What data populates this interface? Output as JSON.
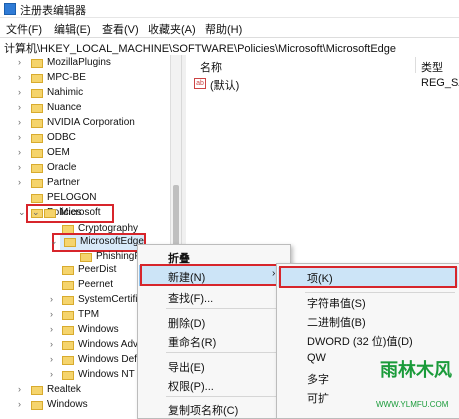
{
  "window": {
    "title": "注册表编辑器"
  },
  "menus": [
    "文件(F)",
    "编辑(E)",
    "查看(V)",
    "收藏夹(A)",
    "帮助(H)"
  ],
  "address": "计算机\\HKEY_LOCAL_MACHINE\\SOFTWARE\\Policies\\Microsoft\\MicrosoftEdge",
  "tree": {
    "items": [
      {
        "label": "MozillaPlugins",
        "arrow": "›"
      },
      {
        "label": "MPC-BE",
        "arrow": "›"
      },
      {
        "label": "Nahimic",
        "arrow": "›"
      },
      {
        "label": "Nuance",
        "arrow": "›"
      },
      {
        "label": "NVIDIA Corporation",
        "arrow": "›"
      },
      {
        "label": "ODBC",
        "arrow": "›"
      },
      {
        "label": "OEM",
        "arrow": "›"
      },
      {
        "label": "Oracle",
        "arrow": "›"
      },
      {
        "label": "Partner",
        "arrow": "›"
      },
      {
        "label": "PELOGON",
        "arrow": ""
      },
      {
        "label": "Policies",
        "arrow": "⌄"
      },
      {
        "label": "Microsoft",
        "arrow": "⌄"
      },
      {
        "label": "Cryptography",
        "arrow": ""
      },
      {
        "label": "MicrosoftEdge",
        "arrow": "⌄"
      },
      {
        "label": "PhishingFi",
        "arrow": ""
      },
      {
        "label": "PeerDist",
        "arrow": ""
      },
      {
        "label": "Peernet",
        "arrow": ""
      },
      {
        "label": "SystemCertific",
        "arrow": "›"
      },
      {
        "label": "TPM",
        "arrow": "›"
      },
      {
        "label": "Windows",
        "arrow": "›"
      },
      {
        "label": "Windows Adv",
        "arrow": "›"
      },
      {
        "label": "Windows Defe",
        "arrow": "›"
      },
      {
        "label": "Windows NT",
        "arrow": "›"
      },
      {
        "label": "Realtek",
        "arrow": "›"
      },
      {
        "label": "Windows",
        "arrow": "›"
      },
      {
        "label": "Windo",
        "arrow": "›"
      }
    ]
  },
  "list": {
    "columns": {
      "name": "名称",
      "type": "类型"
    },
    "rows": [
      {
        "icon": "ab",
        "name": "(默认)",
        "type": "REG_SZ"
      }
    ]
  },
  "context_menu": {
    "items": [
      "折叠",
      "新建(N)",
      "查找(F)...",
      "删除(D)",
      "重命名(R)",
      "导出(E)",
      "权限(P)...",
      "复制项名称(C)"
    ],
    "submenu_arrow": "›"
  },
  "submenu": {
    "items": [
      "项(K)",
      "字符串值(S)",
      "二进制值(B)",
      "DWORD (32 位)值(D)",
      "QW",
      "多字",
      "可扩"
    ]
  },
  "watermark": {
    "text": "雨林木风",
    "url": "WWW.YLMFU.COM"
  },
  "colors": {
    "highlight": "#d7252b",
    "selection": "#cce4f7",
    "folder": "#f5d46c"
  }
}
